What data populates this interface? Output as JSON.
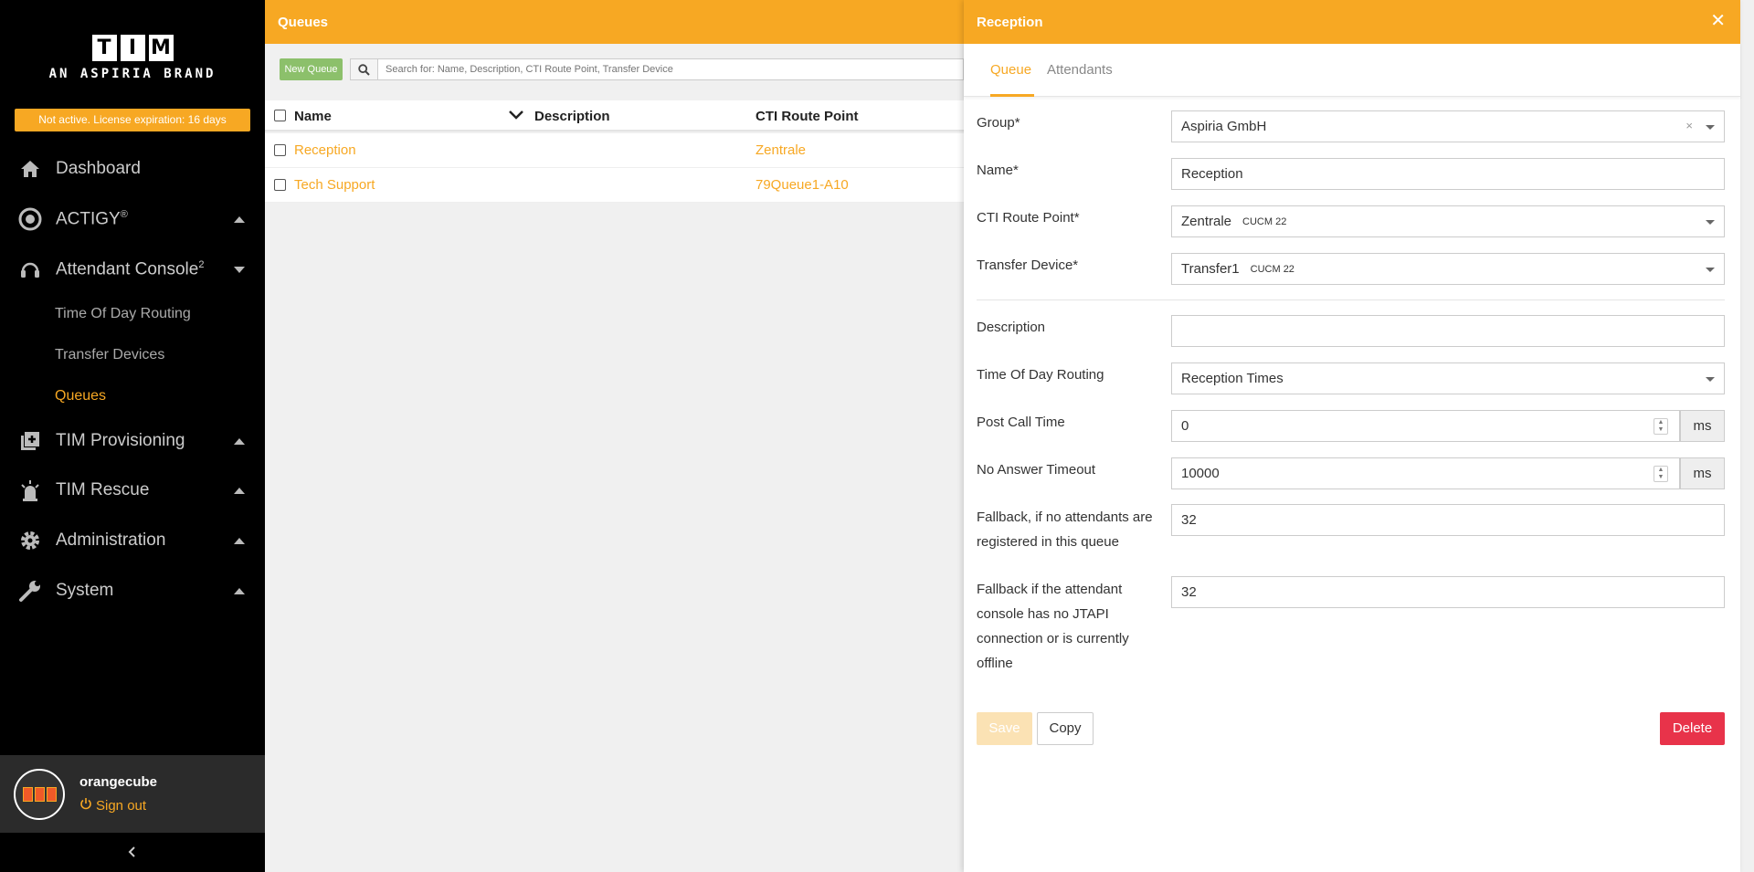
{
  "brand": {
    "logo_letters": [
      "T",
      "I",
      "M"
    ],
    "tagline": "AN ASPIRIA BRAND"
  },
  "license_notice": "Not active. License expiration: 16 days",
  "sidebar": {
    "dashboard": "Dashboard",
    "actigy": "ACTIGY",
    "actigy_sup": "®",
    "attendant": "Attendant Console",
    "attendant_sup": "2",
    "sub_items": [
      "Time Of Day Routing",
      "Transfer Devices",
      "Queues"
    ],
    "provisioning": "TIM Provisioning",
    "rescue": "TIM Rescue",
    "administration": "Administration",
    "system": "System"
  },
  "user": {
    "name": "orangecube",
    "sign_out": "Sign out"
  },
  "list": {
    "title": "Queues",
    "new_button": "New Queue",
    "search_placeholder": "Search for: Name, Description, CTI Route Point, Transfer Device",
    "columns": [
      "Name",
      "Description",
      "CTI Route Point"
    ],
    "rows": [
      {
        "name": "Reception",
        "description": "",
        "cti": "Zentrale"
      },
      {
        "name": "Tech Support",
        "description": "",
        "cti": "79Queue1-A10"
      }
    ]
  },
  "panel": {
    "title": "Reception",
    "tabs": [
      "Queue",
      "Attendants"
    ],
    "labels": {
      "group": "Group*",
      "name": "Name*",
      "cti": "CTI Route Point*",
      "transfer": "Transfer Device*",
      "description": "Description",
      "tod": "Time Of Day Routing",
      "post_call": "Post Call Time",
      "no_answer": "No Answer Timeout",
      "fallback1_a": "Fallback, if no attendants are",
      "fallback1_b": "registered in this queue",
      "fallback2_a": "Fallback if the attendant",
      "fallback2_b": "console has no JTAPI",
      "fallback2_c": "connection or is currently",
      "fallback2_d": "offline"
    },
    "values": {
      "group": "Aspiria GmbH",
      "name": "Reception",
      "cti": "Zentrale",
      "cti_tag": "CUCM 22",
      "transfer": "Transfer1",
      "transfer_tag": "CUCM 22",
      "description": "",
      "tod": "Reception Times",
      "post_call": "0",
      "no_answer": "10000",
      "unit": "ms",
      "fallback1": "32",
      "fallback2": "32"
    },
    "buttons": {
      "save": "Save",
      "copy": "Copy",
      "delete": "Delete"
    }
  },
  "colors": {
    "accent": "#f7a823",
    "sidebar_bg": "#000000",
    "new_button": "#8cc06b",
    "delete": "#e8334a"
  }
}
